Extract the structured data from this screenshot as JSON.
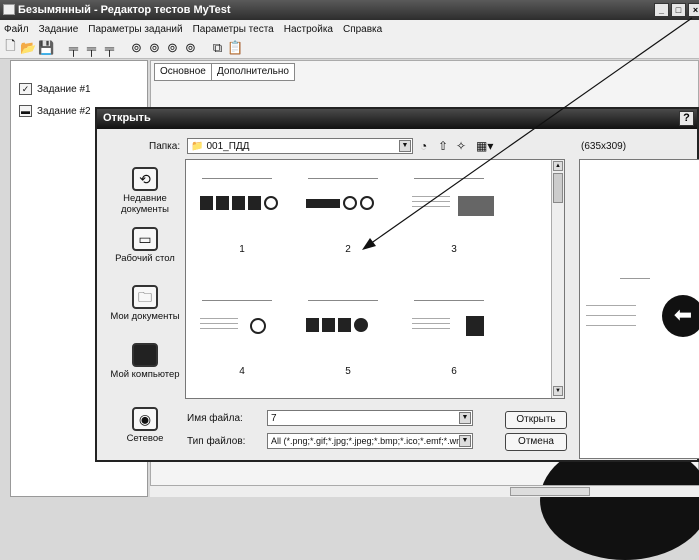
{
  "window": {
    "title": "Безымянный - Редактор тестов MyTest"
  },
  "menu": [
    "Файл",
    "Задание",
    "Параметры заданий",
    "Параметры теста",
    "Настройка",
    "Справка"
  ],
  "tree": [
    "Задание #1",
    "Задание #2"
  ],
  "editor_tabs": [
    "Основное",
    "Дополнительно"
  ],
  "dialog": {
    "title": "Открыть",
    "help": "?",
    "folder_label": "Папка:",
    "folder_value": "001_ПДД",
    "preview_size": "(635x309)",
    "places": [
      "Недавние документы",
      "Рабочий стол",
      "Мои документы",
      "Мой компьютер",
      "Сетевое"
    ],
    "thumbnails": [
      "1",
      "2",
      "3",
      "4",
      "5",
      "6"
    ],
    "filename_label": "Имя файла:",
    "filename_value": "7",
    "filetype_label": "Тип файлов:",
    "filetype_value": "All (*.png;*.gif;*.jpg;*.jpeg;*.bmp;*.ico;*.emf;*.wm",
    "open_button": "Открыть",
    "cancel_button": "Отмена"
  }
}
